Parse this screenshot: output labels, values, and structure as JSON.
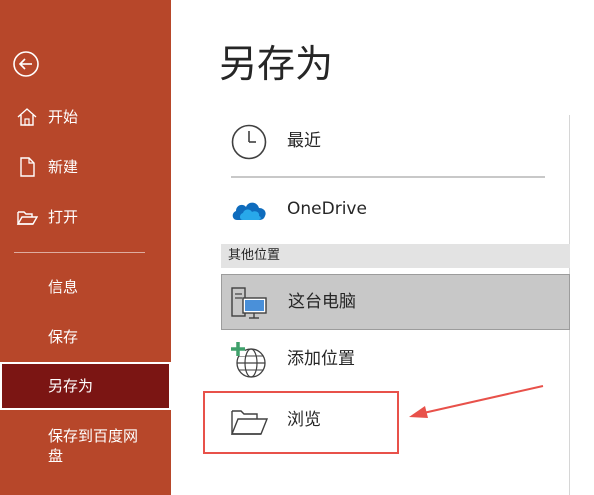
{
  "sidebar": {
    "back_icon": "back-arrow-icon",
    "items": [
      {
        "label": "开始",
        "icon": "home-icon"
      },
      {
        "label": "新建",
        "icon": "new-document-icon"
      },
      {
        "label": "打开",
        "icon": "open-folder-icon"
      },
      {
        "label": "信息"
      },
      {
        "label": "保存"
      },
      {
        "label": "另存为",
        "active": true
      },
      {
        "label": "保存到百度网盘"
      }
    ],
    "background_color": "#b7472a",
    "active_color": "#7b1513"
  },
  "main": {
    "title": "另存为",
    "locations": [
      {
        "label": "最近",
        "icon": "clock-icon"
      },
      {
        "label": "OneDrive",
        "icon": "onedrive-cloud-icon"
      }
    ],
    "other_locations_header": "其他位置",
    "other_locations": [
      {
        "label": "这台电脑",
        "icon": "computer-icon",
        "selected": true
      },
      {
        "label": "添加位置",
        "icon": "add-location-globe-icon"
      },
      {
        "label": "浏览",
        "icon": "folder-browse-icon"
      }
    ]
  },
  "annotation": {
    "color": "#e8514a"
  }
}
